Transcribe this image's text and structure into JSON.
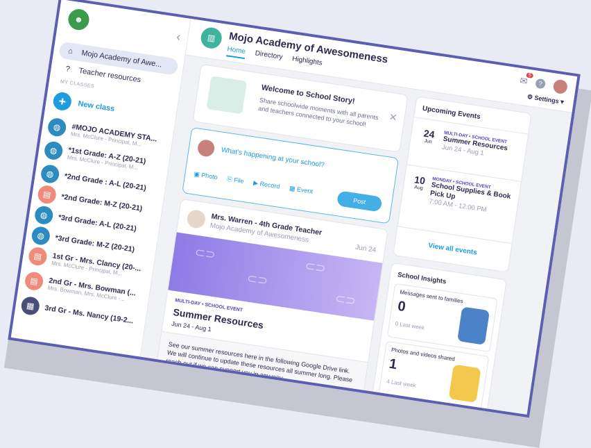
{
  "sidebar": {
    "school_item": "Mojo Academy of Awe...",
    "teacher_resources": "Teacher resources",
    "section_label": "MY CLASSES",
    "new_class": "New class",
    "classes": [
      {
        "name": "#MOJO ACADEMY STA...",
        "sub": "Mrs. McClure - Principal, M..."
      },
      {
        "name": "*1st Grade: A-Z (20-21)",
        "sub": "Mrs. McClure - Principal, M..."
      },
      {
        "name": "*2nd Grade : A-L (20-21)",
        "sub": ""
      },
      {
        "name": "*2nd Grade: M-Z (20-21)",
        "sub": ""
      },
      {
        "name": "*3rd Grade: A-L (20-21)",
        "sub": ""
      },
      {
        "name": "*3rd Grade: M-Z (20-21)",
        "sub": ""
      },
      {
        "name": "1st Gr - Mrs. Clancy (20-...",
        "sub": "Mrs. McClure - Principal, M..."
      },
      {
        "name": "2nd Gr - Mrs. Bowman (...",
        "sub": "Mrs. Bowman, Mrs. McClure -..."
      },
      {
        "name": "3rd Gr - Ms. Nancy (19-2...",
        "sub": ""
      }
    ]
  },
  "header": {
    "school_name": "Mojo Academy of Awesomeness",
    "tabs": [
      "Home",
      "Directory",
      "Highlights"
    ],
    "notif_count": "5",
    "settings": "Settings"
  },
  "welcome": {
    "title": "Welcome to School Story!",
    "subtitle": "Share schoolwide moments with all parents and teachers connected to your school!"
  },
  "composer": {
    "placeholder": "What's happening at your school?",
    "actions": [
      "Photo",
      "File",
      "Record",
      "Event"
    ],
    "post": "Post"
  },
  "post": {
    "author": "Mrs. Warren - 4th Grade Teacher",
    "school": "Mojo Academy of Awesomeness",
    "date": "Jun 24",
    "type": "MULTI-DAY • SCHOOL EVENT",
    "title": "Summer Resources",
    "dates": "Jun 24 - Aug 1",
    "body": "See our summer resources here in the following Google Drive link. We will continue to update these resources all summer long. Please reach out if we can support you in any way."
  },
  "events": {
    "title": "Upcoming Events",
    "items": [
      {
        "day": "24",
        "month": "Jun",
        "type": "MULTI-DAY • SCHOOL EVENT",
        "name": "Summer Resources",
        "time": "Jun 24 - Aug 1"
      },
      {
        "day": "10",
        "month": "Aug",
        "type": "MONDAY • SCHOOL EVENT",
        "name": "School Supplies & Book Pick Up",
        "time": "7:00 AM - 12:00 PM"
      }
    ],
    "view_all": "View all events"
  },
  "insights": {
    "title": "School Insights",
    "metrics": [
      {
        "label": "Messages sent to families",
        "value": "0",
        "sub": "0 Last week"
      },
      {
        "label": "Photos and videos shared",
        "value": "1",
        "sub": "4 Last week"
      }
    ]
  }
}
